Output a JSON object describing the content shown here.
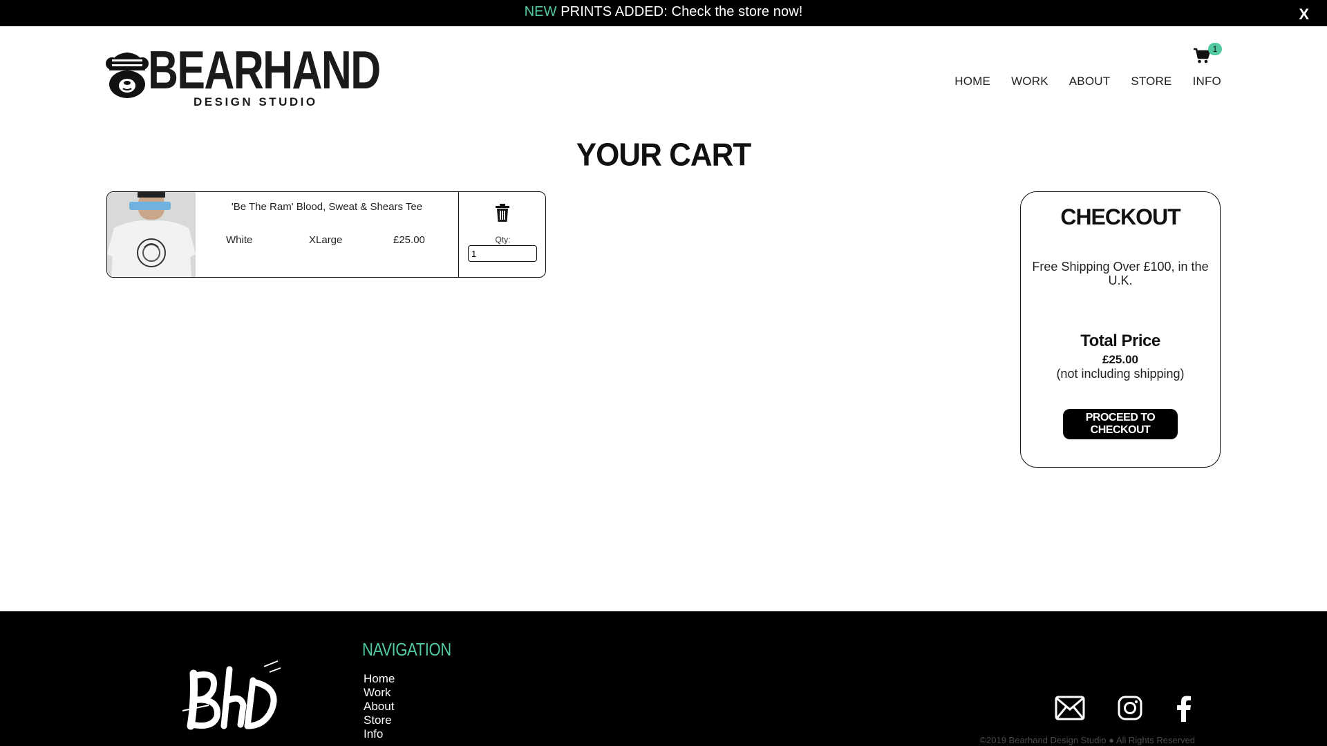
{
  "announcement": {
    "highlight": "NEW",
    "text": " PRINTS ADDED: Check the store now!",
    "close_label": "X"
  },
  "header": {
    "logo_word": "BEARHAND",
    "logo_sub": "DESIGN STUDIO",
    "cart_count": "1",
    "nav": [
      {
        "label": "HOME"
      },
      {
        "label": "WORK"
      },
      {
        "label": "ABOUT"
      },
      {
        "label": "STORE"
      },
      {
        "label": "INFO"
      }
    ]
  },
  "page_title": "YOUR CART",
  "cart_item": {
    "name": "'Be The Ram' Blood, Sweat & Shears Tee",
    "color": "White",
    "size": "XLarge",
    "price": "£25.00",
    "qty_label": "Qty:",
    "qty_value": "1"
  },
  "checkout": {
    "title": "CHECKOUT",
    "shipping_note": "Free Shipping Over £100, in the U.K.",
    "total_label": "Total Price",
    "total_value": "£25.00",
    "total_note": "(not including shipping)",
    "button_label": "PROCEED TO CHECKOUT"
  },
  "footer": {
    "nav_title": "NAVIGATION",
    "links": [
      {
        "label": "Home"
      },
      {
        "label": "Work"
      },
      {
        "label": "About"
      },
      {
        "label": "Store"
      },
      {
        "label": "Info"
      }
    ],
    "copyright": "©2019 Bearhand Design Studio ● All Rights Reserved"
  },
  "icons": {
    "cart": "cart-icon",
    "trash": "trash-icon",
    "email": "email-icon",
    "instagram": "instagram-icon",
    "facebook": "facebook-icon"
  },
  "colors": {
    "accent": "#52c9a0",
    "bar": "#000000"
  }
}
